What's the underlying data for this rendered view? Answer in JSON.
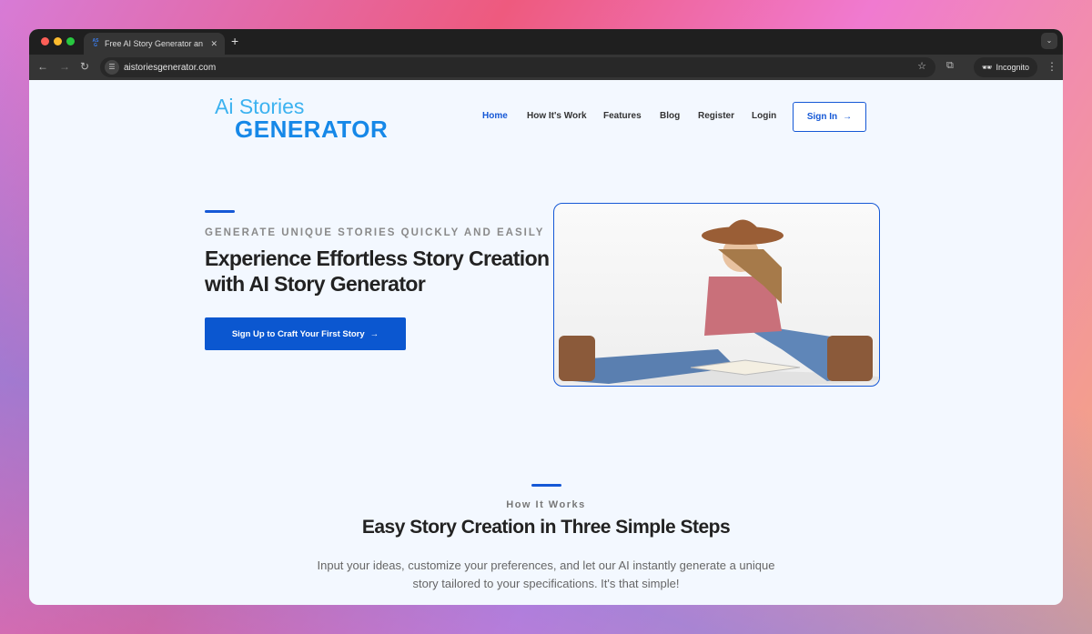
{
  "browser": {
    "tab_title": "Free AI Story Generator and W",
    "url": "aistoriesgenerator.com",
    "incognito_label": "Incognito",
    "favicon_text": "ASG"
  },
  "header": {
    "logo_line1": "Ai Stories",
    "logo_line2": "GENERATOR",
    "nav": [
      "Home",
      "How It's Work",
      "Features",
      "Blog",
      "Register",
      "Login"
    ],
    "sign_in": "Sign In"
  },
  "hero": {
    "eyebrow": "GENERATE UNIQUE STORIES QUICKLY AND EASILY",
    "title": "Experience Effortless Story Creation with AI Story Generator",
    "cta": "Sign Up to Craft Your First Story"
  },
  "how": {
    "eyebrow": "How It Works",
    "title": "Easy Story Creation in Three Simple Steps",
    "description": "Input your ideas, customize your preferences, and let our AI instantly generate a unique story tailored to your specifications. It's that simple!"
  },
  "colors": {
    "accent": "#1558d6",
    "logo_light": "#3cb2f0",
    "logo_dark": "#1688e8"
  }
}
